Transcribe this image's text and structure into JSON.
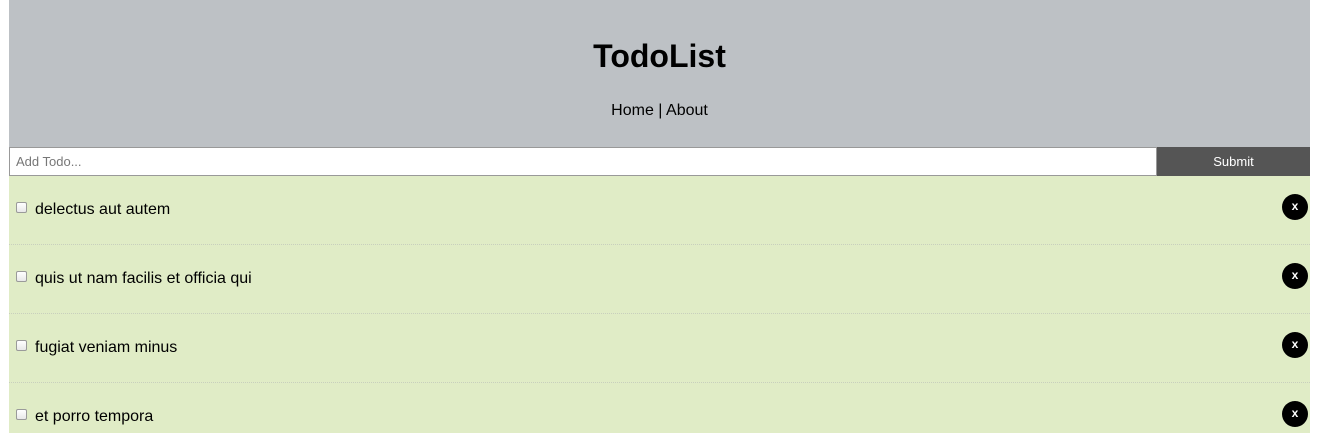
{
  "header": {
    "title": "TodoList",
    "nav": {
      "home": "Home",
      "separator": " | ",
      "about": "About"
    }
  },
  "add_form": {
    "placeholder": "Add Todo...",
    "value": "",
    "submit_label": "Submit"
  },
  "todos": [
    {
      "title": "delectus aut autem",
      "completed": false,
      "delete_label": "x"
    },
    {
      "title": "quis ut nam facilis et officia qui",
      "completed": false,
      "delete_label": "x"
    },
    {
      "title": "fugiat veniam minus",
      "completed": false,
      "delete_label": "x"
    },
    {
      "title": "et porro tempora",
      "completed": false,
      "delete_label": "x"
    }
  ],
  "colors": {
    "header_bg": "#bdc1c5",
    "item_bg": "#e0ecc6",
    "submit_bg": "#555555",
    "delete_bg": "#000000"
  }
}
